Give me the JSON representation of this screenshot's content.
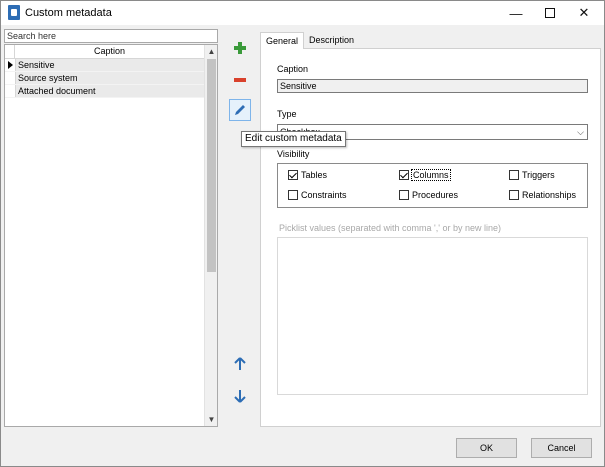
{
  "window": {
    "title": "Custom metadata",
    "minimize_glyph": "—",
    "close_glyph": "✕"
  },
  "list": {
    "search_placeholder": "Search here",
    "column_header": "Caption",
    "rows": [
      "Sensitive",
      "Source system",
      "Attached document"
    ],
    "selected_index": 0,
    "scroll_up_glyph": "▲",
    "scroll_down_glyph": "▼"
  },
  "toolbar": {
    "add_icon": "plus-icon",
    "remove_icon": "minus-icon",
    "edit_icon": "pencil-icon",
    "move_up_icon": "arrow-up-icon",
    "move_down_icon": "arrow-down-icon",
    "edit_tooltip": "Edit custom metadata"
  },
  "tabs": {
    "general": "General",
    "description": "Description",
    "active": "General"
  },
  "general": {
    "caption_label": "Caption",
    "caption_value": "Sensitive",
    "type_label": "Type",
    "type_value": "Checkbox",
    "type_chevron": "⌵",
    "visibility_label": "Visibility",
    "visibility": {
      "tables": {
        "label": "Tables",
        "checked": true
      },
      "columns": {
        "label": "Columns",
        "checked": true
      },
      "triggers": {
        "label": "Triggers",
        "checked": false
      },
      "constraints": {
        "label": "Constraints",
        "checked": false
      },
      "procedures": {
        "label": "Procedures",
        "checked": false
      },
      "relationships": {
        "label": "Relationships",
        "checked": false
      }
    },
    "picklist_label": "Picklist values  (separated with comma ',' or by new line)",
    "picklist_value": ""
  },
  "footer": {
    "ok": "OK",
    "cancel": "Cancel"
  },
  "colors": {
    "accent": "#2d6db5",
    "add_green": "#3a9a3a",
    "remove_red": "#d9412c",
    "edit_blue": "#2d6db5"
  }
}
